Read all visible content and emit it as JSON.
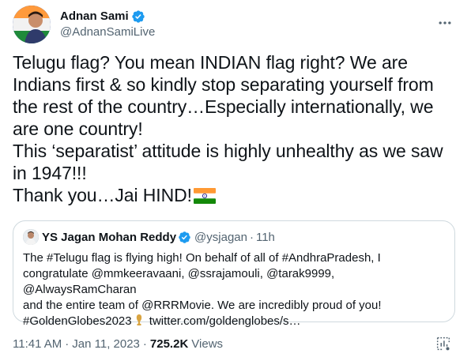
{
  "author": {
    "name": "Adnan Sami",
    "handle": "@AdnanSamiLive",
    "verified": true
  },
  "tweet_text": "Telugu flag? You mean INDIAN flag right? We are\nIndians first & so kindly stop separating yourself from\nthe rest of the country…Especially internationally, we\nare one country!\nThis ‘separatist’ attitude is highly unhealthy as we saw\nin 1947!!!\nThank you…Jai HIND!",
  "quoted": {
    "name": "YS Jagan Mohan Reddy",
    "handle": "@ysjagan",
    "separator": "·",
    "time": "11h",
    "text_before_trophy": "The #Telugu flag is flying high! On behalf of all of #AndhraPradesh, I\ncongratulate @mmkeeravaani, @ssrajamouli, @tarak9999, @AlwaysRamCharan\nand the entire team of @RRRMovie. We are incredibly proud of you!\n#GoldenGlobes2023",
    "text_after_trophy": "twitter.com/goldenglobes/s…"
  },
  "meta": {
    "time": "11:41 AM",
    "date": "Jan 11, 2023",
    "dot": "·",
    "views_count": "725.2K",
    "views_label": "Views"
  },
  "icons": {
    "verified": "verified-badge-icon",
    "more": "more-options-icon",
    "analytics": "analytics-icon",
    "flag": "india-flag-emoji",
    "trophy": "trophy-emoji"
  },
  "colors": {
    "verified_blue": "#1d9bf0",
    "text": "#0f1419",
    "secondary": "#536471",
    "border": "#cfd9de",
    "saffron": "#ff9933",
    "green": "#138808",
    "chakra": "#000080"
  }
}
